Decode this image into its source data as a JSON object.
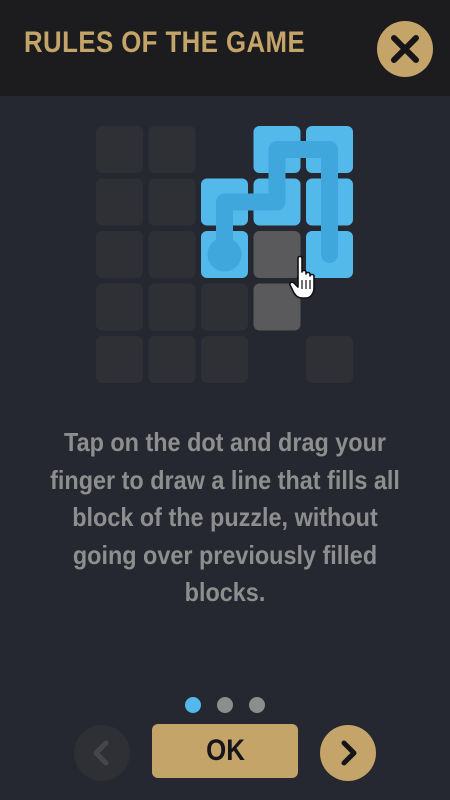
{
  "header": {
    "title": "RULES OF THE GAME",
    "close_icon": "close-icon"
  },
  "puzzle": {
    "rows": 5,
    "cols": 5,
    "filled_cells": [
      [
        0,
        3
      ],
      [
        0,
        4
      ],
      [
        1,
        2
      ],
      [
        1,
        3
      ],
      [
        1,
        4
      ],
      [
        2,
        2
      ],
      [
        2,
        4
      ]
    ],
    "highlighted_cells": [
      [
        2,
        3
      ],
      [
        3,
        3
      ]
    ],
    "hidden_cells": [
      [
        0,
        2
      ],
      [
        3,
        4
      ],
      [
        4,
        3
      ]
    ],
    "line_path": [
      [
        2,
        2
      ],
      [
        1,
        2
      ],
      [
        1,
        3
      ],
      [
        0,
        3
      ],
      [
        0,
        4
      ],
      [
        1,
        4
      ],
      [
        2,
        4
      ]
    ],
    "start_dot_cell": [
      2,
      2
    ],
    "pointer_icon": "hand-pointer-icon"
  },
  "tutorial": {
    "text": "Tap on the dot and drag your finger to draw a line that fills all block of the puzzle, without going over previously filled blocks."
  },
  "pagination": {
    "pages": 3,
    "current": 1
  },
  "footer": {
    "prev_icon": "chevron-left-icon",
    "ok_label": "OK",
    "next_icon": "chevron-right-icon"
  },
  "colors": {
    "accent_gold": "#c4a468",
    "puzzle_blue": "#52b9ea",
    "line_blue": "#3fa7dc",
    "background": "#252830",
    "header_bg": "#1c1c1f",
    "empty_cell": "#2e3036",
    "highlight_cell": "#5a5a5c",
    "text_gray": "#8e8e8e"
  }
}
